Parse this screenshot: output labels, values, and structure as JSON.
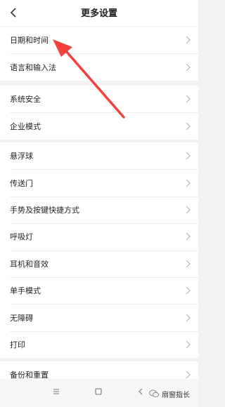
{
  "header": {
    "title": "更多设置"
  },
  "sections": [
    {
      "items": [
        {
          "label": "日期和时间"
        },
        {
          "label": "语言和输入法"
        }
      ]
    },
    {
      "items": [
        {
          "label": "系统安全"
        },
        {
          "label": "企业模式"
        }
      ]
    },
    {
      "items": [
        {
          "label": "悬浮球"
        },
        {
          "label": "传送门"
        },
        {
          "label": "手势及按键快捷方式"
        },
        {
          "label": "呼吸灯"
        },
        {
          "label": "耳机和音效"
        },
        {
          "label": "单手模式"
        },
        {
          "label": "无障碍"
        },
        {
          "label": "打印"
        }
      ]
    },
    {
      "items": [
        {
          "label": "备份和重置"
        }
      ]
    }
  ],
  "watermark": {
    "text": "扇窗指长"
  },
  "colors": {
    "accent_arrow": "#f0413b",
    "chevron": "#b5b5b5",
    "background": "#f2f2f2"
  },
  "icons": [
    "back-arrow-icon",
    "chevron-right-icon",
    "menu-icon",
    "home-icon",
    "back-icon",
    "wechat-icon"
  ]
}
